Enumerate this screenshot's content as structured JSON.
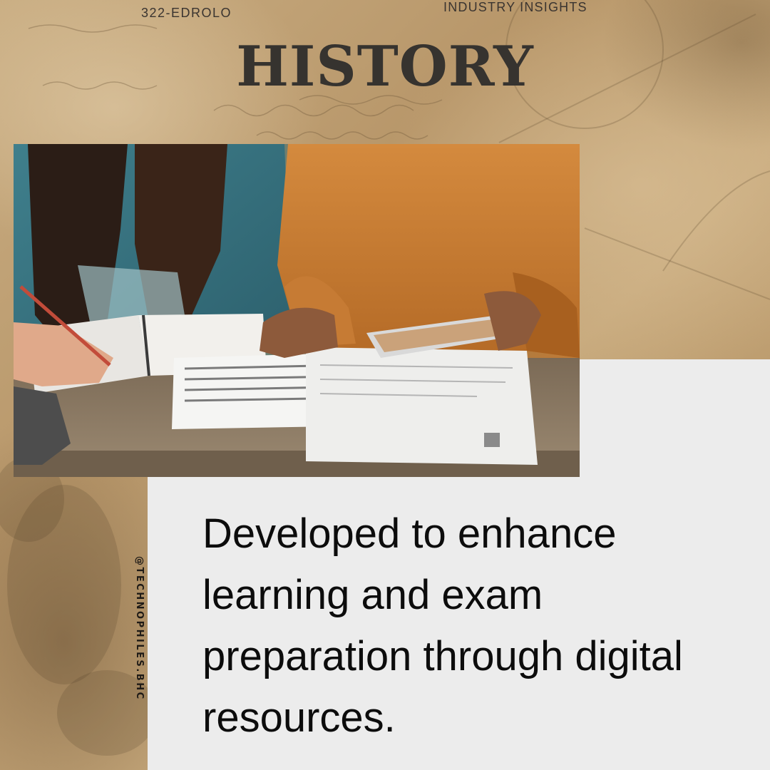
{
  "header": {
    "brand_tag": "322-EDROLO",
    "section_tag": "INDUSTRY INSIGHTS",
    "title": "HISTORY"
  },
  "main": {
    "photo_alt": "Two students studying at a table with notebooks, papers and a tablet",
    "body_text": "Developed to enhance learning and exam preparation through digital resources."
  },
  "footer": {
    "handle": "@TECHNOPHILES.BHC"
  },
  "colors": {
    "parchment": "#b99a6e",
    "panel": "#ececec",
    "title": "#36332f",
    "text": "#0c0c0c"
  }
}
